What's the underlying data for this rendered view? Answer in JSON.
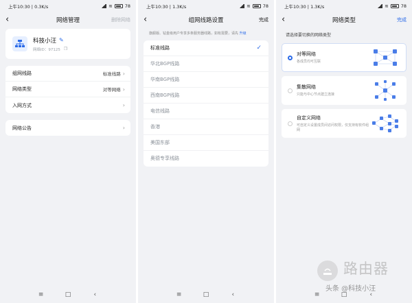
{
  "status": {
    "time": "上午10:30",
    "speed1": "0.3K/s",
    "speed2": "1.3K/s",
    "speed3": "1.3K/s",
    "battery": "78"
  },
  "screen1": {
    "title": "网络管理",
    "action": "删除网络",
    "profile": {
      "name": "科技小汪",
      "id_label": "网络ID：97125"
    },
    "rows": [
      {
        "label": "组网线路",
        "value": "标准线路"
      },
      {
        "label": "网络类型",
        "value": "对等网络"
      },
      {
        "label": "入网方式",
        "value": ""
      }
    ],
    "announce": {
      "label": "网络公告"
    }
  },
  "screen2": {
    "title": "组网线路设置",
    "action": "完成",
    "desc": "旗舰版、钻金级用户专享多条服务器线路，如有需要，请先",
    "upgrade": "升级",
    "lines": [
      "标准线路",
      "华北BGP线路",
      "华南BGP线路",
      "西南BGP线路",
      "电信线路",
      "香港",
      "美国东部",
      "奥德专享线路"
    ]
  },
  "screen3": {
    "title": "网络类型",
    "action": "完成",
    "hint": "请选择要切换的网络类型",
    "types": [
      {
        "name": "对等网络",
        "desc": "各成员均可互联"
      },
      {
        "name": "集散网络",
        "desc": "只能与中心节点建立连接"
      },
      {
        "name": "自定义网络",
        "desc": "可自定义设置成员间访问权限，仅支持有软件组网"
      }
    ]
  },
  "watermark": {
    "logo_text": "路由器",
    "sub": "头条 @科技小汪"
  },
  "colors": {
    "accent": "#2a6ae8",
    "node": "#4a7de8",
    "bg": "#f1f2f5"
  }
}
